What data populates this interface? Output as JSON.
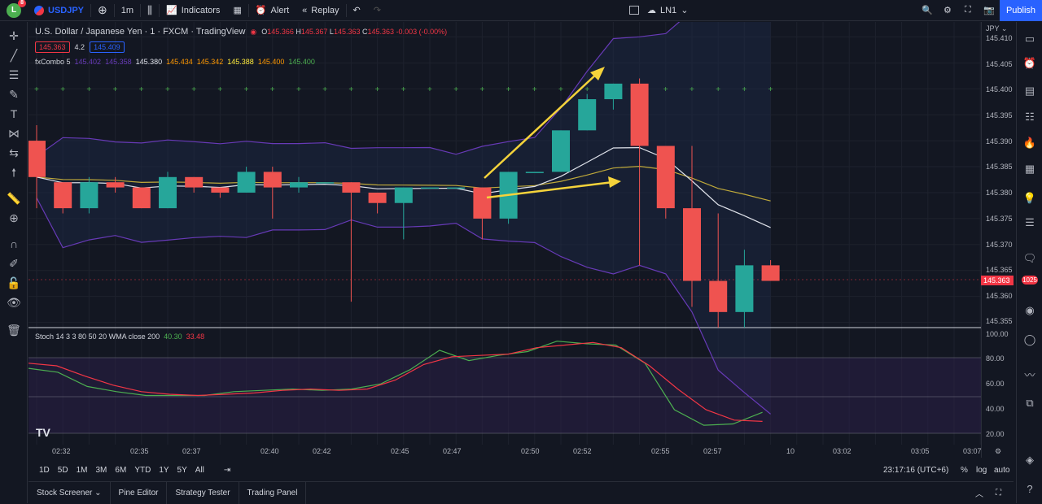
{
  "topbar": {
    "avatar_letter": "L",
    "avatar_badge": "8",
    "symbol": "USDJPY",
    "interval": "1m",
    "indicators": "Indicators",
    "alert": "Alert",
    "replay": "Replay",
    "layout_name": "LN1",
    "publish": "Publish"
  },
  "legend": {
    "title": "U.S. Dollar / Japanese Yen · 1 · FXCM · TradingView",
    "o_label": "O",
    "o": "145.366",
    "h_label": "H",
    "h": "145.367",
    "l_label": "L",
    "l": "145.363",
    "c_label": "C",
    "c": "145.363",
    "change": "-0.003 (-0.00%)",
    "bid": "145.363",
    "spread": "4.2",
    "ask": "145.409",
    "fxcombo_name": "fxCombo 5",
    "fxcombo_values": [
      "145.402",
      "145.358",
      "145.380",
      "145.434",
      "145.342",
      "145.388",
      "145.400",
      "145.400"
    ],
    "stoch_name": "Stoch 14 3 3 80 50 20 WMA close 200",
    "stoch_k": "40.30",
    "stoch_d": "33.48"
  },
  "price_axis": {
    "currency": "JPY",
    "labels": [
      "145.410",
      "145.405",
      "145.400",
      "145.395",
      "145.390",
      "145.385",
      "145.380",
      "145.375",
      "145.370",
      "145.365",
      "145.360",
      "145.355"
    ],
    "current": "145.363",
    "stoch_labels": [
      "100.00",
      "80.00",
      "60.00",
      "40.00",
      "20.00"
    ]
  },
  "time_axis": [
    "02:32",
    "02:35",
    "02:37",
    "02:40",
    "02:42",
    "02:45",
    "02:47",
    "02:50",
    "02:52",
    "02:55",
    "02:57",
    "10",
    "03:02",
    "03:05",
    "03:07"
  ],
  "right_badge": "1025",
  "bottom": {
    "ranges": [
      "1D",
      "5D",
      "1M",
      "3M",
      "6M",
      "YTD",
      "1Y",
      "5Y",
      "All"
    ],
    "clock": "23:17:16 (UTC+6)",
    "percent": "%",
    "log": "log",
    "auto": "auto"
  },
  "panels": [
    "Stock Screener",
    "Pine Editor",
    "Strategy Tester",
    "Trading Panel"
  ],
  "colors": {
    "up": "#26a69a",
    "down": "#ef5350",
    "accent": "#2962ff",
    "arrow": "#f5d33b"
  },
  "chart_data": {
    "type": "candlestick",
    "candles": [
      {
        "o": 145.39,
        "h": 145.393,
        "l": 145.377,
        "c": 145.383
      },
      {
        "o": 145.382,
        "h": 145.382,
        "l": 145.376,
        "c": 145.377
      },
      {
        "o": 145.377,
        "h": 145.383,
        "l": 145.376,
        "c": 145.382
      },
      {
        "o": 145.382,
        "h": 145.383,
        "l": 145.38,
        "c": 145.381
      },
      {
        "o": 145.381,
        "h": 145.381,
        "l": 145.377,
        "c": 145.377
      },
      {
        "o": 145.377,
        "h": 145.384,
        "l": 145.377,
        "c": 145.383
      },
      {
        "o": 145.383,
        "h": 145.383,
        "l": 145.38,
        "c": 145.381
      },
      {
        "o": 145.381,
        "h": 145.381,
        "l": 145.379,
        "c": 145.38
      },
      {
        "o": 145.38,
        "h": 145.385,
        "l": 145.38,
        "c": 145.384
      },
      {
        "o": 145.384,
        "h": 145.385,
        "l": 145.375,
        "c": 145.381
      },
      {
        "o": 145.381,
        "h": 145.383,
        "l": 145.38,
        "c": 145.382
      },
      {
        "o": 145.382,
        "h": 145.382,
        "l": 145.382,
        "c": 145.382
      },
      {
        "o": 145.382,
        "h": 145.382,
        "l": 145.359,
        "c": 145.38
      },
      {
        "o": 145.38,
        "h": 145.38,
        "l": 145.376,
        "c": 145.378
      },
      {
        "o": 145.378,
        "h": 145.381,
        "l": 145.371,
        "c": 145.381
      },
      {
        "o": 145.381,
        "h": 145.381,
        "l": 145.381,
        "c": 145.381
      },
      {
        "o": 145.381,
        "h": 145.381,
        "l": 145.381,
        "c": 145.381
      },
      {
        "o": 145.381,
        "h": 145.381,
        "l": 145.371,
        "c": 145.375
      },
      {
        "o": 145.375,
        "h": 145.384,
        "l": 145.374,
        "c": 145.384
      },
      {
        "o": 145.384,
        "h": 145.384,
        "l": 145.384,
        "c": 145.384
      },
      {
        "o": 145.384,
        "h": 145.392,
        "l": 145.384,
        "c": 145.392
      },
      {
        "o": 145.392,
        "h": 145.399,
        "l": 145.392,
        "c": 145.398
      },
      {
        "o": 145.398,
        "h": 145.401,
        "l": 145.396,
        "c": 145.401
      },
      {
        "o": 145.401,
        "h": 145.402,
        "l": 145.366,
        "c": 145.389
      },
      {
        "o": 145.389,
        "h": 145.389,
        "l": 145.375,
        "c": 145.377
      },
      {
        "o": 145.377,
        "h": 145.389,
        "l": 145.358,
        "c": 145.363
      },
      {
        "o": 145.363,
        "h": 145.376,
        "l": 145.354,
        "c": 145.357
      },
      {
        "o": 145.357,
        "h": 145.369,
        "l": 145.354,
        "c": 145.366
      },
      {
        "o": 145.366,
        "h": 145.367,
        "l": 145.363,
        "c": 145.363
      }
    ],
    "ylim": [
      145.354,
      145.411
    ],
    "stoch_k": [
      74,
      71,
      60,
      56,
      53,
      53,
      53,
      56,
      57,
      58,
      57,
      58,
      62,
      73,
      88,
      80,
      84,
      87,
      95,
      93,
      92,
      78,
      42,
      30,
      31,
      40
    ],
    "stoch_d": [
      78,
      76,
      68,
      61,
      56,
      54,
      53,
      54,
      55,
      57,
      58,
      57,
      58,
      65,
      77,
      83,
      84,
      85,
      90,
      92,
      94,
      90,
      76,
      58,
      42,
      34,
      33
    ],
    "stoch_ylim": [
      15,
      103
    ]
  }
}
